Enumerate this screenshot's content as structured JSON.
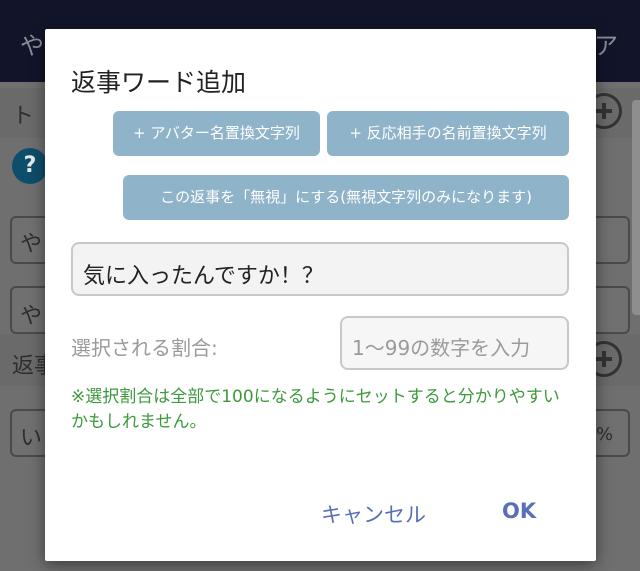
{
  "dialog": {
    "title": "返事ワード追加",
    "avatar_button": "+ アバター名置換文字列",
    "partner_button": "+ 反応相手の名前置換文字列",
    "ignore_button": "この返事を「無視」にする(無視文字列のみになります)",
    "reply_value": "気に入ったんですか！？",
    "ratio_label": "選択される割合:",
    "ratio_placeholder": "1〜99の数字を入力",
    "note": "※選択割合は全部で100になるようにセットすると分かりやすいかもしれません。",
    "cancel_label": "キャンセル",
    "ok_label": "OK"
  },
  "background": {
    "header_left": "や",
    "header_right": "ア",
    "section1_label": "ト",
    "help_glyph": "?",
    "field1_text": "や",
    "field2_text": "や",
    "section2_label": "返事",
    "field3_text": "い",
    "percent_text": "%"
  },
  "colors": {
    "pill_button": "#8fb3c9",
    "action_text": "#5a6fb7",
    "note_text": "#3c9a3c",
    "header": "#12152a"
  }
}
